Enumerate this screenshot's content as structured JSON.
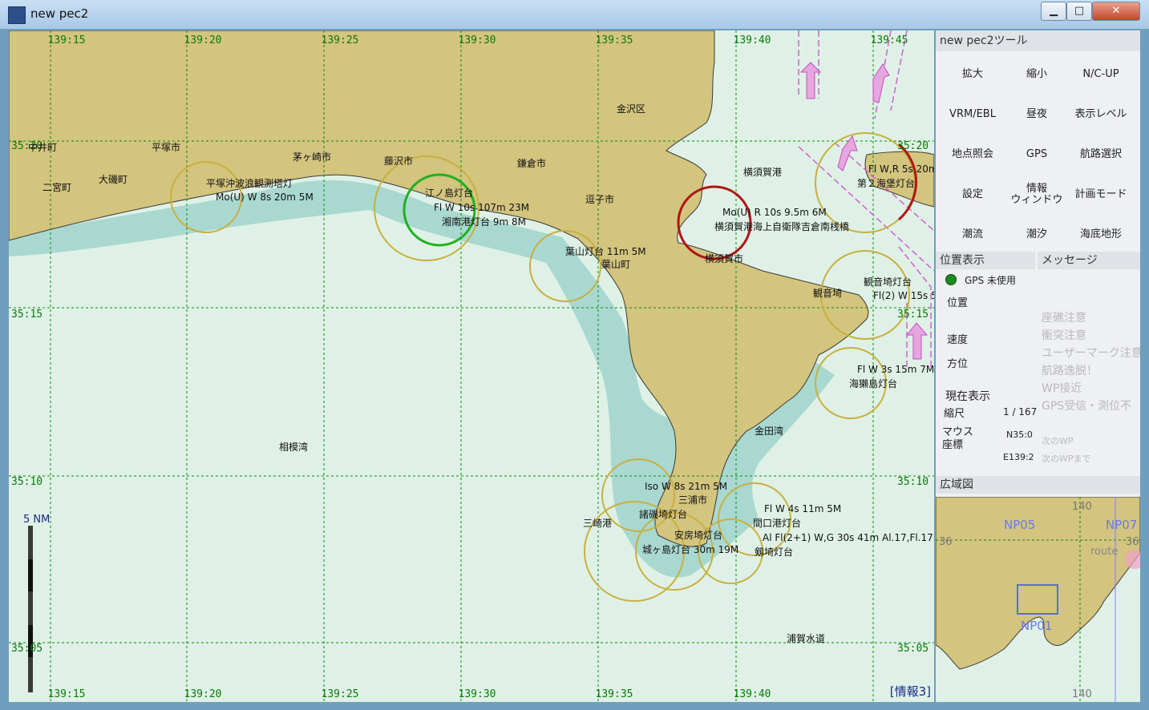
{
  "window": {
    "title": "new pec2",
    "minimize": "▁",
    "maximize": "□",
    "close": "✕"
  },
  "map": {
    "top_ticks": [
      "139:15",
      "139:20",
      "139:25",
      "139:30",
      "139:35",
      "139:40",
      "139:45"
    ],
    "bottom_ticks": [
      "139:15",
      "139:20",
      "139:25",
      "139:30",
      "139:35",
      "139:40"
    ],
    "left_ticks": [
      "35:20",
      "35:15",
      "35:10",
      "35:05"
    ],
    "right_ticks": [
      "35:20",
      "35:15",
      "35:10",
      "35:05"
    ],
    "scale_label": "5  NM",
    "info_tag": "[情報3]",
    "place_names": [
      "中井町",
      "平塚市",
      "茅ヶ崎市",
      "藤沢市",
      "鎌倉市",
      "金沢区",
      "二宮町",
      "大磯町",
      "横須賀港",
      "逗子市",
      "葉山町",
      "横須賀市",
      "観音埼",
      "相模湾",
      "金田湾",
      "三浦市",
      "三崎港",
      "浦賀水道"
    ],
    "lights": [
      "平塚沖波浪観測塔灯",
      "Mo(U) W 8s 20m 5M",
      "江ノ島灯台",
      "Fl W 10s 107m 23M",
      "湘南港灯台 9m 8M",
      "葉山灯台 11m 5M",
      "Mo(U) R 10s 9.5m 6M",
      "横須賀港海上自衛隊吉倉南桟橋",
      "Fl W,R 5s 20m",
      "第２海堡灯台",
      "観音埼灯台",
      "Fl(2) W 15s 5",
      "Fl W 3s 15m 7M",
      "海獺島灯台",
      "Iso W 8s 21m 5M",
      "諸磯埼灯台",
      "Fl W 4s 11m 5M",
      "間口港灯台",
      "安房埼灯台",
      "城ヶ島灯台 30m 19M",
      "Al Fl(2+1) W,G 30s 41m Al.17,Fl.17M",
      "剱埼灯台"
    ],
    "colors": {
      "land": "#d3c47e",
      "sea_deep": "#dff1e6",
      "sea_shallow": "#a9d8d0",
      "grid": "#0a8a0a",
      "ring": "#c8b040",
      "route": "#d060d0"
    }
  },
  "panel": {
    "title": "new pec2ツール",
    "tools": [
      "拡大",
      "縮小",
      "N/C-UP",
      "VRM/EBL",
      "昼夜",
      "表示レベル",
      "地点照会",
      "GPS",
      "航路選択",
      "設定",
      "情報\nウィンドウ",
      "計画モード",
      "潮流",
      "潮汐",
      "海底地形"
    ],
    "position": {
      "header": "位置表示",
      "gps_status": "GPS 未使用",
      "pos_label": "位置",
      "speed_label": "速度",
      "heading_label": "方位"
    },
    "messages": {
      "header": "メッセージ",
      "items": [
        "座礁注意",
        "衝突注意",
        "ユーザーマーク注意",
        "航路逸脱！",
        "WP接近",
        "GPS受信・測位不"
      ],
      "small_items": [
        "次のWP",
        "次のWPまで"
      ]
    },
    "current": {
      "header": "現在表示",
      "scale_label": "縮尺",
      "scale_value": "1 / 167",
      "mouse_label": "マウス\n座標",
      "lat": "N35:0",
      "lon": "E139:2"
    },
    "overview": {
      "header": "広域図",
      "labels": [
        "NP05",
        "NP07",
        "NP01"
      ],
      "ticks": [
        "140",
        "140",
        "36",
        "36"
      ],
      "route_text": "route"
    }
  }
}
